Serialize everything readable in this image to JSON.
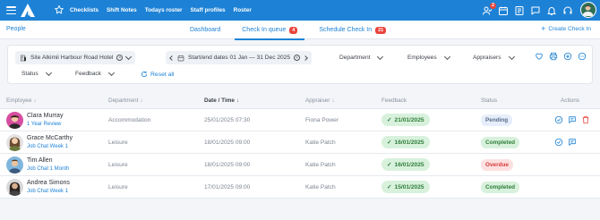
{
  "topbar": {
    "nav": [
      "Checklists",
      "Shift Notes",
      "Todays roster",
      "Staff profiles",
      "Roster"
    ],
    "notification_count": "2",
    "icons": [
      "hamburger-icon",
      "logo-icon",
      "star-icon",
      "person-check-icon",
      "calendar-icon",
      "list-icon",
      "chat-icon",
      "bell-icon",
      "help-icon",
      "avatar"
    ]
  },
  "subheader": {
    "breadcrumb": "People",
    "tabs": [
      {
        "label": "Dashboard",
        "count": ""
      },
      {
        "label": "Check In queue",
        "count": "4"
      },
      {
        "label": "Schedule Check In",
        "count": "21"
      }
    ],
    "create_label": "Create Check In"
  },
  "filters": {
    "site": "Site Alkimii Harbour Road Hotel",
    "dates": "Start/end dates 01 Jan — 31 Dec 2025",
    "department": "Department",
    "employees": "Employees",
    "appraisers": "Appraisers",
    "status": "Status",
    "feedback": "Feedback",
    "reset": "Reset all"
  },
  "table": {
    "headers": {
      "employee": "Employee",
      "department": "Department",
      "date": "Date / Time",
      "appraiser": "Appraiser",
      "feedback": "Feedback",
      "status": "Status",
      "actions": "Actions"
    },
    "rows": [
      {
        "name": "Clara Murray",
        "sub": "1 Year Review",
        "department": "Accommodation",
        "date": "25/01/2025 07:30",
        "appraiser": "Fiona Power",
        "feedback": "21/01/2025",
        "status": "Pending"
      },
      {
        "name": "Grace McCarthy",
        "sub": "Job Chat Week 1",
        "department": "Leisure",
        "date": "18/01/2025 09:00",
        "appraiser": "Katie Patch",
        "feedback": "16/01/2025",
        "status": "Completed"
      },
      {
        "name": "Tim Allen",
        "sub": "Job Chat 1 Month",
        "department": "Leisure",
        "date": "18/01/2025 09:00",
        "appraiser": "Katie Patch",
        "feedback": "16/01/2025",
        "status": "Overdue"
      },
      {
        "name": "Andrea Simons",
        "sub": "Job Chat Week 1",
        "department": "Leisure",
        "date": "17/01/2025 09:00",
        "appraiser": "Katie Patch",
        "feedback": "15/01/2025",
        "status": "Completed"
      }
    ]
  },
  "colors": {
    "brand": "#1d82d6",
    "badge": "#e8453c",
    "success_bg": "#d8f1dc",
    "success_text": "#2e7d3a",
    "overdue_bg": "#fde0e0",
    "overdue_text": "#d63a3a"
  }
}
